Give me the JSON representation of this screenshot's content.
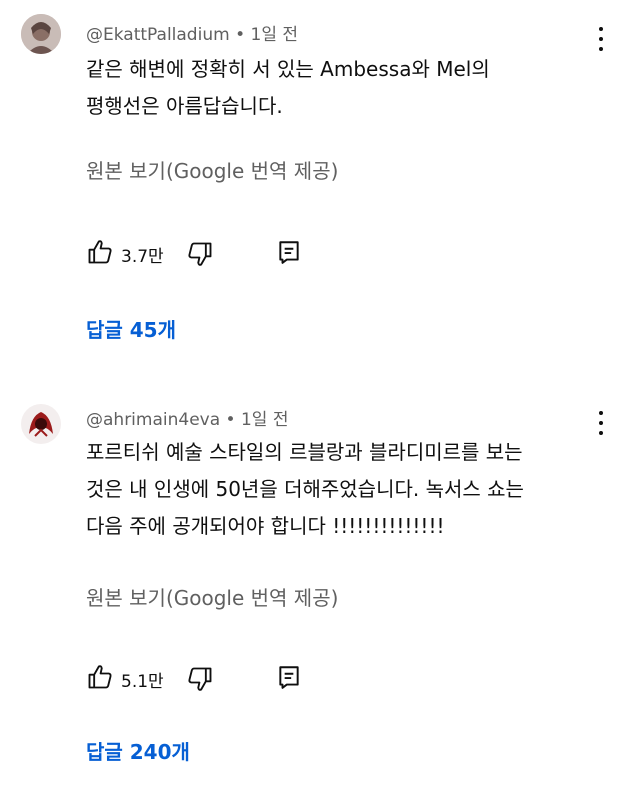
{
  "comments": [
    {
      "author": "@EkattPalladium",
      "separator": "•",
      "time": "1일 전",
      "text_lines": [
        "같은 해변에 정확히 서 있는 Ambessa와 Mel의",
        "평행선은 아름답습니다."
      ],
      "translate_label": "원본 보기(Google 번역 제공)",
      "likes": "3.7만",
      "replies_label": "답글 45개",
      "avatar_colors": [
        "#c9b9b4",
        "#8a6f66"
      ]
    },
    {
      "author": "@ahrimain4eva",
      "separator": "•",
      "time": "1일 전",
      "text_lines": [
        "포르티쉬 예술 스타일의 르블랑과 블라디미르를 보는",
        "것은 내 인생에 50년을 더해주었습니다. 녹서스 쇼는",
        "다음 주에 공개되어야 합니다 !!!!!!!!!!!!!!"
      ],
      "translate_label": "원본 보기(Google 번역 제공)",
      "likes": "5.1만",
      "replies_label": "답글 240개",
      "avatar_colors": [
        "#ffffff",
        "#9b1b1b"
      ]
    }
  ],
  "icons": {
    "like": "thumb-up-icon",
    "dislike": "thumb-down-icon",
    "reply": "reply-icon",
    "more": "more-vert-icon"
  },
  "colors": {
    "link": "#065fd4",
    "secondary_text": "#606060",
    "primary_text": "#0f0f0f"
  }
}
